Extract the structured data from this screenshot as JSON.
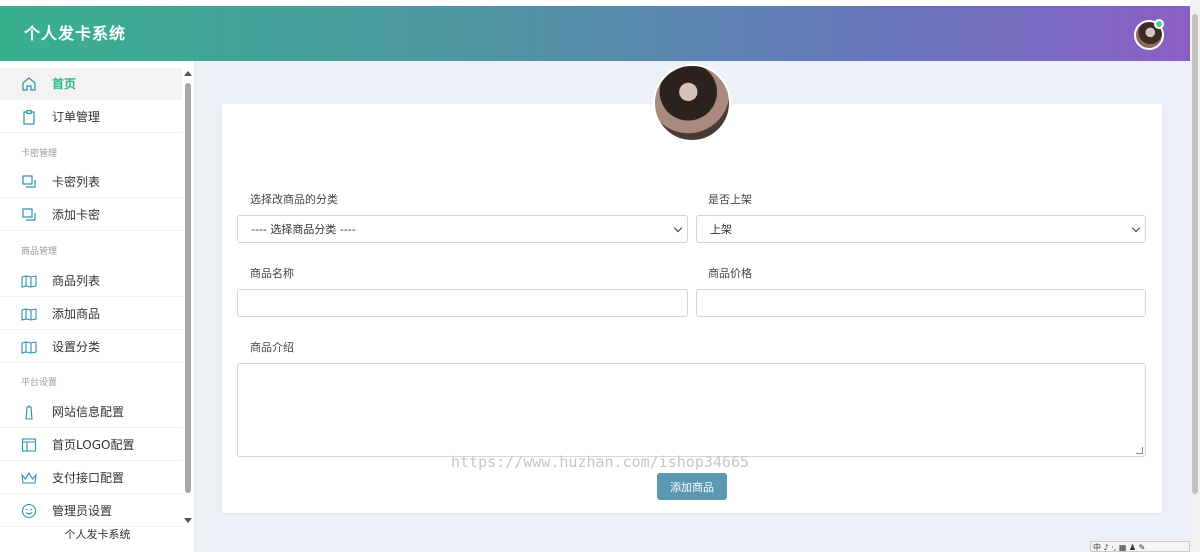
{
  "header": {
    "app_title": "个人发卡系统"
  },
  "sidebar": {
    "items": [
      {
        "label": "首页",
        "icon": "home-icon"
      },
      {
        "label": "订单管理",
        "icon": "clipboard-icon"
      },
      {
        "label": "卡密列表",
        "icon": "copy-icon"
      },
      {
        "label": "添加卡密",
        "icon": "copy-icon"
      },
      {
        "label": "商品列表",
        "icon": "book-icon"
      },
      {
        "label": "添加商品",
        "icon": "book-icon"
      },
      {
        "label": "设置分类",
        "icon": "book-icon"
      },
      {
        "label": "网站信息配置",
        "icon": "tower-icon"
      },
      {
        "label": "首页LOGO配置",
        "icon": "layout-icon"
      },
      {
        "label": "支付接口配置",
        "icon": "crown-icon"
      },
      {
        "label": "管理员设置",
        "icon": "smile-icon"
      }
    ],
    "sections": [
      "卡密管理",
      "商品管理",
      "平台设置"
    ],
    "footer": "个人发卡系统"
  },
  "form": {
    "category_label": "选择改商品的分类",
    "category_value": "---- 选择商品分类 ----",
    "listed_label": "是否上架",
    "listed_value": "上架",
    "name_label": "商品名称",
    "price_label": "商品价格",
    "intro_label": "商品介绍",
    "submit_label": "添加商品"
  },
  "watermark": "https://www.huzhan.com/ishop34665",
  "tray": "中 ♪ ·, ▦ ♟ ✎",
  "colors": {
    "accent": "#2fb38a",
    "button": "#5b98b1",
    "header_start": "#38b08e",
    "header_end": "#8a5fc4"
  }
}
